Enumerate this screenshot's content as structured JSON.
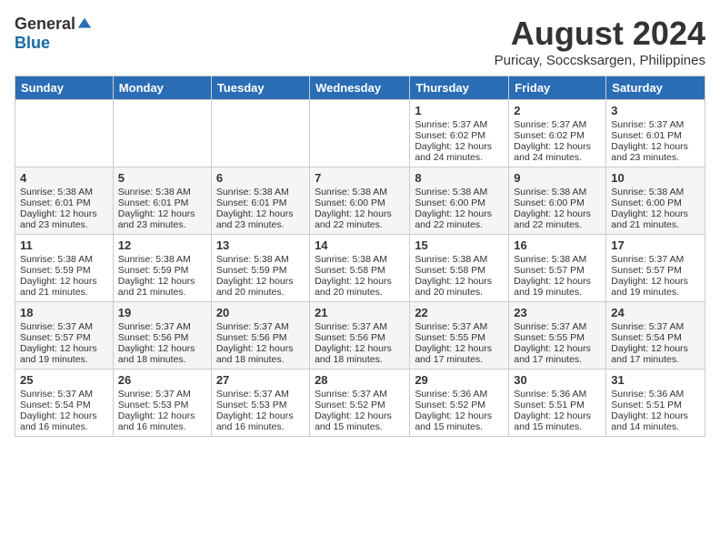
{
  "logo": {
    "general": "General",
    "blue": "Blue"
  },
  "title": "August 2024",
  "location": "Puricay, Soccsksargen, Philippines",
  "weekdays": [
    "Sunday",
    "Monday",
    "Tuesday",
    "Wednesday",
    "Thursday",
    "Friday",
    "Saturday"
  ],
  "weeks": [
    [
      {
        "day": "",
        "sunrise": "",
        "sunset": "",
        "daylight": ""
      },
      {
        "day": "",
        "sunrise": "",
        "sunset": "",
        "daylight": ""
      },
      {
        "day": "",
        "sunrise": "",
        "sunset": "",
        "daylight": ""
      },
      {
        "day": "",
        "sunrise": "",
        "sunset": "",
        "daylight": ""
      },
      {
        "day": "1",
        "sunrise": "Sunrise: 5:37 AM",
        "sunset": "Sunset: 6:02 PM",
        "daylight": "Daylight: 12 hours and 24 minutes."
      },
      {
        "day": "2",
        "sunrise": "Sunrise: 5:37 AM",
        "sunset": "Sunset: 6:02 PM",
        "daylight": "Daylight: 12 hours and 24 minutes."
      },
      {
        "day": "3",
        "sunrise": "Sunrise: 5:37 AM",
        "sunset": "Sunset: 6:01 PM",
        "daylight": "Daylight: 12 hours and 23 minutes."
      }
    ],
    [
      {
        "day": "4",
        "sunrise": "Sunrise: 5:38 AM",
        "sunset": "Sunset: 6:01 PM",
        "daylight": "Daylight: 12 hours and 23 minutes."
      },
      {
        "day": "5",
        "sunrise": "Sunrise: 5:38 AM",
        "sunset": "Sunset: 6:01 PM",
        "daylight": "Daylight: 12 hours and 23 minutes."
      },
      {
        "day": "6",
        "sunrise": "Sunrise: 5:38 AM",
        "sunset": "Sunset: 6:01 PM",
        "daylight": "Daylight: 12 hours and 23 minutes."
      },
      {
        "day": "7",
        "sunrise": "Sunrise: 5:38 AM",
        "sunset": "Sunset: 6:00 PM",
        "daylight": "Daylight: 12 hours and 22 minutes."
      },
      {
        "day": "8",
        "sunrise": "Sunrise: 5:38 AM",
        "sunset": "Sunset: 6:00 PM",
        "daylight": "Daylight: 12 hours and 22 minutes."
      },
      {
        "day": "9",
        "sunrise": "Sunrise: 5:38 AM",
        "sunset": "Sunset: 6:00 PM",
        "daylight": "Daylight: 12 hours and 22 minutes."
      },
      {
        "day": "10",
        "sunrise": "Sunrise: 5:38 AM",
        "sunset": "Sunset: 6:00 PM",
        "daylight": "Daylight: 12 hours and 21 minutes."
      }
    ],
    [
      {
        "day": "11",
        "sunrise": "Sunrise: 5:38 AM",
        "sunset": "Sunset: 5:59 PM",
        "daylight": "Daylight: 12 hours and 21 minutes."
      },
      {
        "day": "12",
        "sunrise": "Sunrise: 5:38 AM",
        "sunset": "Sunset: 5:59 PM",
        "daylight": "Daylight: 12 hours and 21 minutes."
      },
      {
        "day": "13",
        "sunrise": "Sunrise: 5:38 AM",
        "sunset": "Sunset: 5:59 PM",
        "daylight": "Daylight: 12 hours and 20 minutes."
      },
      {
        "day": "14",
        "sunrise": "Sunrise: 5:38 AM",
        "sunset": "Sunset: 5:58 PM",
        "daylight": "Daylight: 12 hours and 20 minutes."
      },
      {
        "day": "15",
        "sunrise": "Sunrise: 5:38 AM",
        "sunset": "Sunset: 5:58 PM",
        "daylight": "Daylight: 12 hours and 20 minutes."
      },
      {
        "day": "16",
        "sunrise": "Sunrise: 5:38 AM",
        "sunset": "Sunset: 5:57 PM",
        "daylight": "Daylight: 12 hours and 19 minutes."
      },
      {
        "day": "17",
        "sunrise": "Sunrise: 5:37 AM",
        "sunset": "Sunset: 5:57 PM",
        "daylight": "Daylight: 12 hours and 19 minutes."
      }
    ],
    [
      {
        "day": "18",
        "sunrise": "Sunrise: 5:37 AM",
        "sunset": "Sunset: 5:57 PM",
        "daylight": "Daylight: 12 hours and 19 minutes."
      },
      {
        "day": "19",
        "sunrise": "Sunrise: 5:37 AM",
        "sunset": "Sunset: 5:56 PM",
        "daylight": "Daylight: 12 hours and 18 minutes."
      },
      {
        "day": "20",
        "sunrise": "Sunrise: 5:37 AM",
        "sunset": "Sunset: 5:56 PM",
        "daylight": "Daylight: 12 hours and 18 minutes."
      },
      {
        "day": "21",
        "sunrise": "Sunrise: 5:37 AM",
        "sunset": "Sunset: 5:56 PM",
        "daylight": "Daylight: 12 hours and 18 minutes."
      },
      {
        "day": "22",
        "sunrise": "Sunrise: 5:37 AM",
        "sunset": "Sunset: 5:55 PM",
        "daylight": "Daylight: 12 hours and 17 minutes."
      },
      {
        "day": "23",
        "sunrise": "Sunrise: 5:37 AM",
        "sunset": "Sunset: 5:55 PM",
        "daylight": "Daylight: 12 hours and 17 minutes."
      },
      {
        "day": "24",
        "sunrise": "Sunrise: 5:37 AM",
        "sunset": "Sunset: 5:54 PM",
        "daylight": "Daylight: 12 hours and 17 minutes."
      }
    ],
    [
      {
        "day": "25",
        "sunrise": "Sunrise: 5:37 AM",
        "sunset": "Sunset: 5:54 PM",
        "daylight": "Daylight: 12 hours and 16 minutes."
      },
      {
        "day": "26",
        "sunrise": "Sunrise: 5:37 AM",
        "sunset": "Sunset: 5:53 PM",
        "daylight": "Daylight: 12 hours and 16 minutes."
      },
      {
        "day": "27",
        "sunrise": "Sunrise: 5:37 AM",
        "sunset": "Sunset: 5:53 PM",
        "daylight": "Daylight: 12 hours and 16 minutes."
      },
      {
        "day": "28",
        "sunrise": "Sunrise: 5:37 AM",
        "sunset": "Sunset: 5:52 PM",
        "daylight": "Daylight: 12 hours and 15 minutes."
      },
      {
        "day": "29",
        "sunrise": "Sunrise: 5:36 AM",
        "sunset": "Sunset: 5:52 PM",
        "daylight": "Daylight: 12 hours and 15 minutes."
      },
      {
        "day": "30",
        "sunrise": "Sunrise: 5:36 AM",
        "sunset": "Sunset: 5:51 PM",
        "daylight": "Daylight: 12 hours and 15 minutes."
      },
      {
        "day": "31",
        "sunrise": "Sunrise: 5:36 AM",
        "sunset": "Sunset: 5:51 PM",
        "daylight": "Daylight: 12 hours and 14 minutes."
      }
    ]
  ]
}
